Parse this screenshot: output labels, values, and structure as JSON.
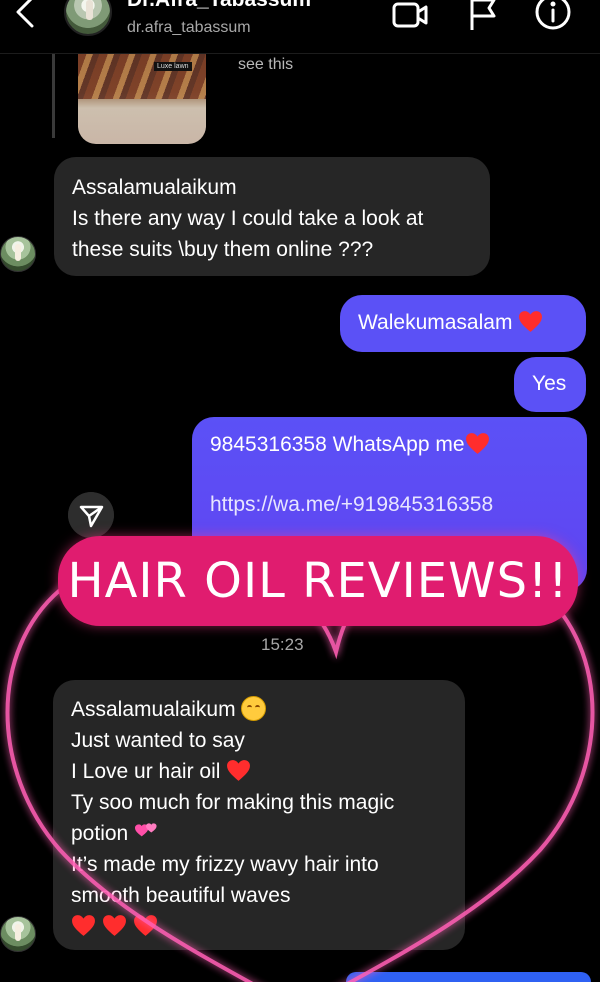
{
  "header": {
    "back_icon": "chevron-left-icon",
    "name": "Dr.Afra_Tabassum",
    "handle": "dr.afra_tabassum",
    "icons": [
      "video-call-icon",
      "flag-icon",
      "info-icon"
    ]
  },
  "shared_post": {
    "preview_label": "Luxe lawn",
    "caption": "see this"
  },
  "messages": {
    "incoming_1": {
      "line1": "Assalamualaikum",
      "line2": "Is there any way I could take a look at",
      "line3": "these suits \\buy them online ???"
    },
    "outgoing_1": {
      "text": "Walekumasalam"
    },
    "outgoing_2": {
      "text": "Yes"
    },
    "outgoing_3": {
      "text": "9845316358 WhatsApp me",
      "link": "https://wa.me/+919845316358"
    },
    "timestamp": "15:23",
    "incoming_2": {
      "line1": "Assalamualaikum",
      "line2": "Just wanted to say",
      "line3": "I Love ur hair oil",
      "line4": "Ty soo much for making this magic",
      "line5": "potion",
      "line6": "It’s made my frizzy wavy hair into",
      "line7": "smooth beautiful waves"
    }
  },
  "overlay": {
    "banner_text": "HAIR OIL REVIEWS!!"
  },
  "colors": {
    "outgoing_bubble": "#5b51f6",
    "incoming_bubble": "#262626",
    "banner": "#e01c6f",
    "neon_pink": "#ff4fa8"
  }
}
